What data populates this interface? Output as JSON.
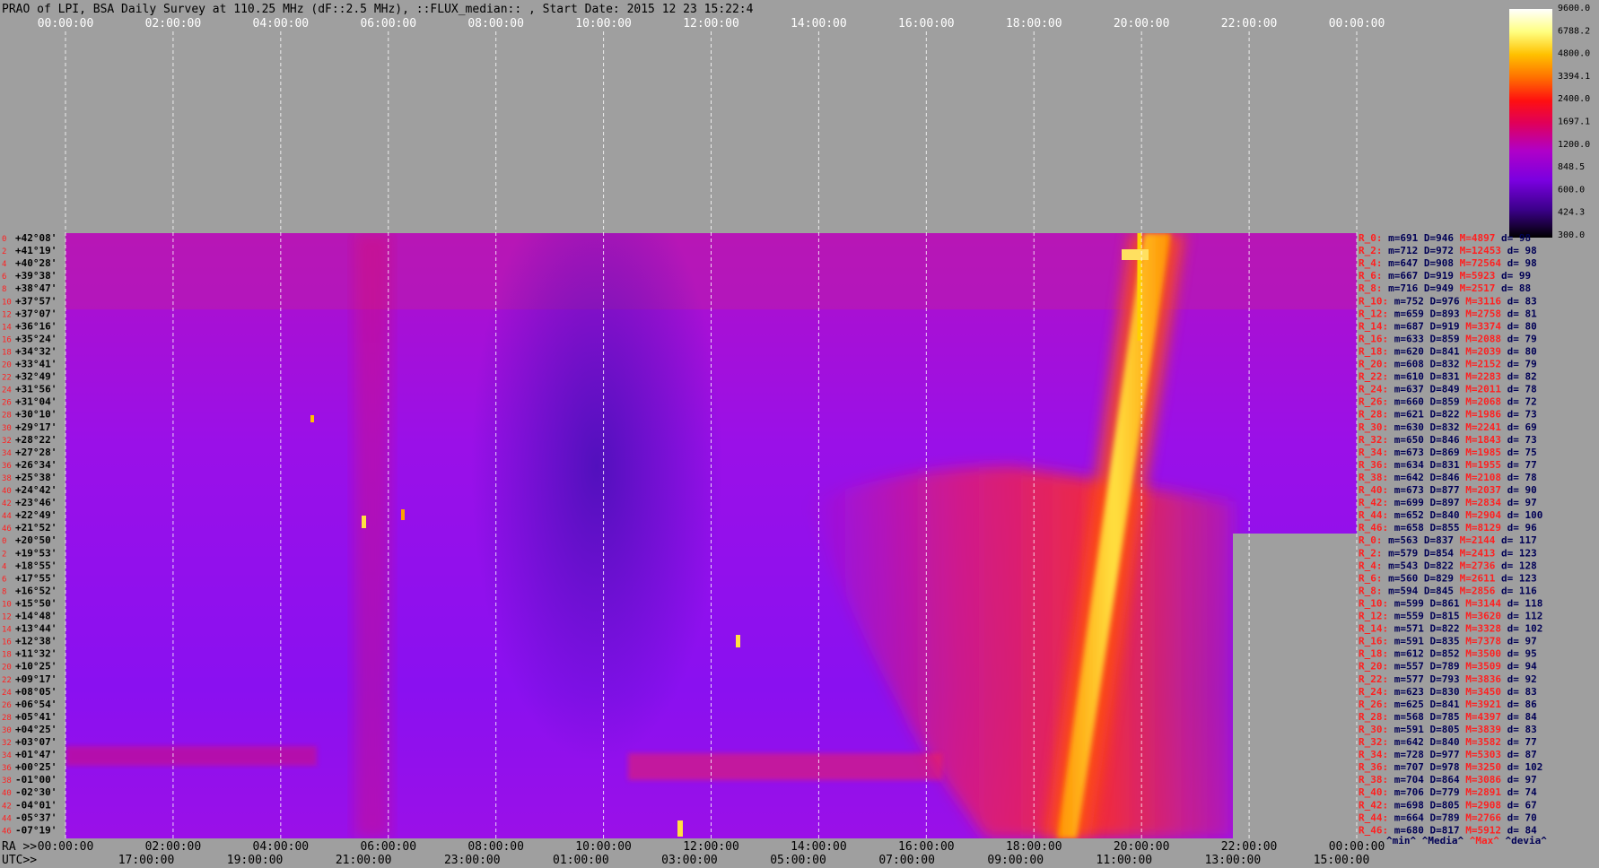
{
  "chart_data": {
    "type": "heatmap",
    "title": "PRAO of LPI, BSA Daily Survey at 110.25 MHz (dF::2.5 MHz), ::FLUX_median:: , Start Date: 2015 12 23 15:22:4",
    "top_time_ticks": [
      "00:00:00",
      "02:00:00",
      "04:00:00",
      "06:00:00",
      "08:00:00",
      "10:00:00",
      "12:00:00",
      "14:00:00",
      "16:00:00",
      "18:00:00",
      "20:00:00",
      "22:00:00",
      "00:00:00"
    ],
    "ra_axis_label": "RA >>",
    "ra_ticks": [
      "00:00:00",
      "02:00:00",
      "04:00:00",
      "06:00:00",
      "08:00:00",
      "10:00:00",
      "12:00:00",
      "14:00:00",
      "16:00:00",
      "18:00:00",
      "20:00:00",
      "22:00:00",
      "00:00:00"
    ],
    "utc_axis_label": "UTC>>",
    "utc_ticks": [
      "17:00:00",
      "19:00:00",
      "21:00:00",
      "23:00:00",
      "01:00:00",
      "03:00:00",
      "05:00:00",
      "07:00:00",
      "09:00:00",
      "11:00:00",
      "13:00:00",
      "15:00:00"
    ],
    "colorbar": {
      "ticks": [
        "9600.0",
        "6788.2",
        "4800.0",
        "3394.1",
        "2400.0",
        "1697.1",
        "1200.0",
        "848.5",
        "600.0",
        "424.3",
        "300.0"
      ],
      "range": [
        300,
        9600
      ],
      "scale": "log",
      "colors": [
        "#000000",
        "#3a0088",
        "#7a00e0",
        "#b000c8",
        "#e0005a",
        "#ff1010",
        "#ff7000",
        "#ffc000",
        "#ffff80",
        "#ffffff"
      ]
    },
    "beams": [
      {
        "idx": "0",
        "dec": "+42°08'"
      },
      {
        "idx": "2",
        "dec": "+41°19'"
      },
      {
        "idx": "4",
        "dec": "+40°28'"
      },
      {
        "idx": "6",
        "dec": "+39°38'"
      },
      {
        "idx": "8",
        "dec": "+38°47'"
      },
      {
        "idx": "10",
        "dec": "+37°57'"
      },
      {
        "idx": "12",
        "dec": "+37°07'"
      },
      {
        "idx": "14",
        "dec": "+36°16'"
      },
      {
        "idx": "16",
        "dec": "+35°24'"
      },
      {
        "idx": "18",
        "dec": "+34°32'"
      },
      {
        "idx": "20",
        "dec": "+33°41'"
      },
      {
        "idx": "22",
        "dec": "+32°49'"
      },
      {
        "idx": "24",
        "dec": "+31°56'"
      },
      {
        "idx": "26",
        "dec": "+31°04'"
      },
      {
        "idx": "28",
        "dec": "+30°10'"
      },
      {
        "idx": "30",
        "dec": "+29°17'"
      },
      {
        "idx": "32",
        "dec": "+28°22'"
      },
      {
        "idx": "34",
        "dec": "+27°28'"
      },
      {
        "idx": "36",
        "dec": "+26°34'"
      },
      {
        "idx": "38",
        "dec": "+25°38'"
      },
      {
        "idx": "40",
        "dec": "+24°42'"
      },
      {
        "idx": "42",
        "dec": "+23°46'"
      },
      {
        "idx": "44",
        "dec": "+22°49'"
      },
      {
        "idx": "46",
        "dec": "+21°52'"
      },
      {
        "idx": "0",
        "dec": "+20°50'"
      },
      {
        "idx": "2",
        "dec": "+19°53'"
      },
      {
        "idx": "4",
        "dec": "+18°55'"
      },
      {
        "idx": "6",
        "dec": "+17°55'"
      },
      {
        "idx": "8",
        "dec": "+16°52'"
      },
      {
        "idx": "10",
        "dec": "+15°50'"
      },
      {
        "idx": "12",
        "dec": "+14°48'"
      },
      {
        "idx": "14",
        "dec": "+13°44'"
      },
      {
        "idx": "16",
        "dec": "+12°38'"
      },
      {
        "idx": "18",
        "dec": "+11°32'"
      },
      {
        "idx": "20",
        "dec": "+10°25'"
      },
      {
        "idx": "22",
        "dec": "+09°17'"
      },
      {
        "idx": "24",
        "dec": "+08°05'"
      },
      {
        "idx": "26",
        "dec": "+06°54'"
      },
      {
        "idx": "28",
        "dec": "+05°41'"
      },
      {
        "idx": "30",
        "dec": "+04°25'"
      },
      {
        "idx": "32",
        "dec": "+03°07'"
      },
      {
        "idx": "34",
        "dec": "+01°47'"
      },
      {
        "idx": "36",
        "dec": "+00°25'"
      },
      {
        "idx": "38",
        "dec": "-01°00'"
      },
      {
        "idx": "40",
        "dec": "-02°30'"
      },
      {
        "idx": "42",
        "dec": "-04°01'"
      },
      {
        "idx": "44",
        "dec": "-05°37'"
      },
      {
        "idx": "46",
        "dec": "-07°19'"
      }
    ],
    "stats": [
      {
        "label": "R_0:",
        "min": "691",
        "median": "946",
        "max": "4897",
        "dev": "98"
      },
      {
        "label": "R_2:",
        "min": "712",
        "median": "972",
        "max": "12453",
        "dev": "98"
      },
      {
        "label": "R_4:",
        "min": "647",
        "median": "908",
        "max": "72564",
        "dev": "98"
      },
      {
        "label": "R_6:",
        "min": "667",
        "median": "919",
        "max": "5923",
        "dev": "99"
      },
      {
        "label": "R_8:",
        "min": "716",
        "median": "949",
        "max": "2517",
        "dev": "88"
      },
      {
        "label": "R_10:",
        "min": "752",
        "median": "976",
        "max": "3116",
        "dev": "83"
      },
      {
        "label": "R_12:",
        "min": "659",
        "median": "893",
        "max": "2758",
        "dev": "81"
      },
      {
        "label": "R_14:",
        "min": "687",
        "median": "919",
        "max": "3374",
        "dev": "80"
      },
      {
        "label": "R_16:",
        "min": "633",
        "median": "859",
        "max": "2088",
        "dev": "79"
      },
      {
        "label": "R_18:",
        "min": "620",
        "median": "841",
        "max": "2039",
        "dev": "80"
      },
      {
        "label": "R_20:",
        "min": "608",
        "median": "832",
        "max": "2152",
        "dev": "79"
      },
      {
        "label": "R_22:",
        "min": "610",
        "median": "831",
        "max": "2283",
        "dev": "82"
      },
      {
        "label": "R_24:",
        "min": "637",
        "median": "849",
        "max": "2011",
        "dev": "78"
      },
      {
        "label": "R_26:",
        "min": "660",
        "median": "859",
        "max": "2068",
        "dev": "72"
      },
      {
        "label": "R_28:",
        "min": "621",
        "median": "822",
        "max": "1986",
        "dev": "73"
      },
      {
        "label": "R_30:",
        "min": "630",
        "median": "832",
        "max": "2241",
        "dev": "69"
      },
      {
        "label": "R_32:",
        "min": "650",
        "median": "846",
        "max": "1843",
        "dev": "73"
      },
      {
        "label": "R_34:",
        "min": "673",
        "median": "869",
        "max": "1985",
        "dev": "75"
      },
      {
        "label": "R_36:",
        "min": "634",
        "median": "831",
        "max": "1955",
        "dev": "77"
      },
      {
        "label": "R_38:",
        "min": "642",
        "median": "846",
        "max": "2108",
        "dev": "78"
      },
      {
        "label": "R_40:",
        "min": "673",
        "median": "877",
        "max": "2037",
        "dev": "90"
      },
      {
        "label": "R_42:",
        "min": "699",
        "median": "897",
        "max": "2834",
        "dev": "97"
      },
      {
        "label": "R_44:",
        "min": "652",
        "median": "840",
        "max": "2904",
        "dev": "100"
      },
      {
        "label": "R_46:",
        "min": "658",
        "median": "855",
        "max": "8129",
        "dev": "96"
      },
      {
        "label": "R_0:",
        "min": "563",
        "median": "837",
        "max": "2144",
        "dev": "117"
      },
      {
        "label": "R_2:",
        "min": "579",
        "median": "854",
        "max": "2413",
        "dev": "123"
      },
      {
        "label": "R_4:",
        "min": "543",
        "median": "822",
        "max": "2736",
        "dev": "128"
      },
      {
        "label": "R_6:",
        "min": "560",
        "median": "829",
        "max": "2611",
        "dev": "123"
      },
      {
        "label": "R_8:",
        "min": "594",
        "median": "845",
        "max": "2856",
        "dev": "116"
      },
      {
        "label": "R_10:",
        "min": "599",
        "median": "861",
        "max": "3144",
        "dev": "118"
      },
      {
        "label": "R_12:",
        "min": "559",
        "median": "815",
        "max": "3620",
        "dev": "112"
      },
      {
        "label": "R_14:",
        "min": "571",
        "median": "822",
        "max": "3328",
        "dev": "102"
      },
      {
        "label": "R_16:",
        "min": "591",
        "median": "835",
        "max": "7378",
        "dev": "97"
      },
      {
        "label": "R_18:",
        "min": "612",
        "median": "852",
        "max": "3500",
        "dev": "95"
      },
      {
        "label": "R_20:",
        "min": "557",
        "median": "789",
        "max": "3509",
        "dev": "94"
      },
      {
        "label": "R_22:",
        "min": "577",
        "median": "793",
        "max": "3836",
        "dev": "92"
      },
      {
        "label": "R_24:",
        "min": "623",
        "median": "830",
        "max": "3450",
        "dev": "83"
      },
      {
        "label": "R_26:",
        "min": "625",
        "median": "841",
        "max": "3921",
        "dev": "86"
      },
      {
        "label": "R_28:",
        "min": "568",
        "median": "785",
        "max": "4397",
        "dev": "84"
      },
      {
        "label": "R_30:",
        "min": "591",
        "median": "805",
        "max": "3839",
        "dev": "83"
      },
      {
        "label": "R_32:",
        "min": "642",
        "median": "840",
        "max": "3582",
        "dev": "77"
      },
      {
        "label": "R_34:",
        "min": "728",
        "median": "977",
        "max": "5303",
        "dev": "87"
      },
      {
        "label": "R_36:",
        "min": "707",
        "median": "978",
        "max": "3250",
        "dev": "102"
      },
      {
        "label": "R_38:",
        "min": "704",
        "median": "864",
        "max": "3086",
        "dev": "97"
      },
      {
        "label": "R_40:",
        "min": "706",
        "median": "779",
        "max": "2891",
        "dev": "74"
      },
      {
        "label": "R_42:",
        "min": "698",
        "median": "805",
        "max": "2908",
        "dev": "67"
      },
      {
        "label": "R_44:",
        "min": "664",
        "median": "789",
        "max": "2766",
        "dev": "70"
      },
      {
        "label": "R_46:",
        "min": "680",
        "median": "817",
        "max": "5912",
        "dev": "84"
      }
    ],
    "stats_legend": [
      "^min^",
      "^Media^",
      "^Max^",
      "^devia^"
    ],
    "colors": {
      "background": "#9f9f9f",
      "beam_index": "#ff2020",
      "stat_label": "#ff2020",
      "stat_text": "#000055",
      "grid": "#ffffff"
    }
  }
}
